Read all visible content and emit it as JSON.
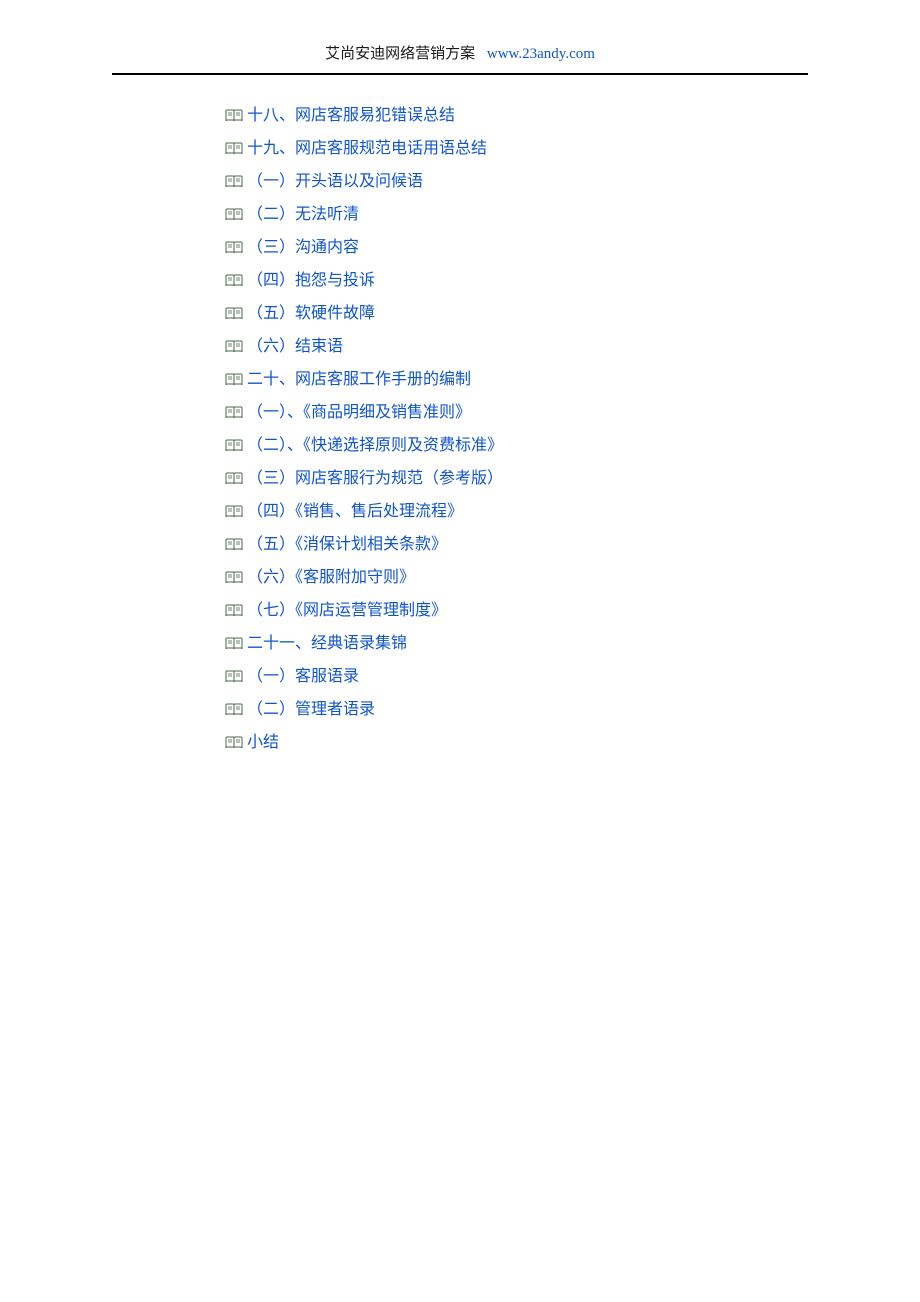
{
  "header": {
    "title": "艾尚安迪网络营销方案",
    "url": "www.23andy.com"
  },
  "toc": [
    {
      "label": "十八、网店客服易犯错误总结"
    },
    {
      "label": "十九、网店客服规范电话用语总结"
    },
    {
      "label": "（一）开头语以及问候语"
    },
    {
      "label": "（二）无法听清"
    },
    {
      "label": "（三）沟通内容"
    },
    {
      "label": "（四）抱怨与投诉"
    },
    {
      "label": "（五）软硬件故障"
    },
    {
      "label": "（六）结束语"
    },
    {
      "label": "二十、网店客服工作手册的编制"
    },
    {
      "label": "（一）、《商品明细及销售准则》"
    },
    {
      "label": "（二）、《快递选择原则及资费标准》"
    },
    {
      "label": "（三）网店客服行为规范（参考版）"
    },
    {
      "label": "（四）《销售、售后处理流程》"
    },
    {
      "label": "（五）《消保计划相关条款》"
    },
    {
      "label": "（六）《客服附加守则》"
    },
    {
      "label": "（七）《网店运营管理制度》"
    },
    {
      "label": "二十一、经典语录集锦"
    },
    {
      "label": "（一）客服语录"
    },
    {
      "label": "（二）管理者语录"
    },
    {
      "label": "小结"
    }
  ]
}
